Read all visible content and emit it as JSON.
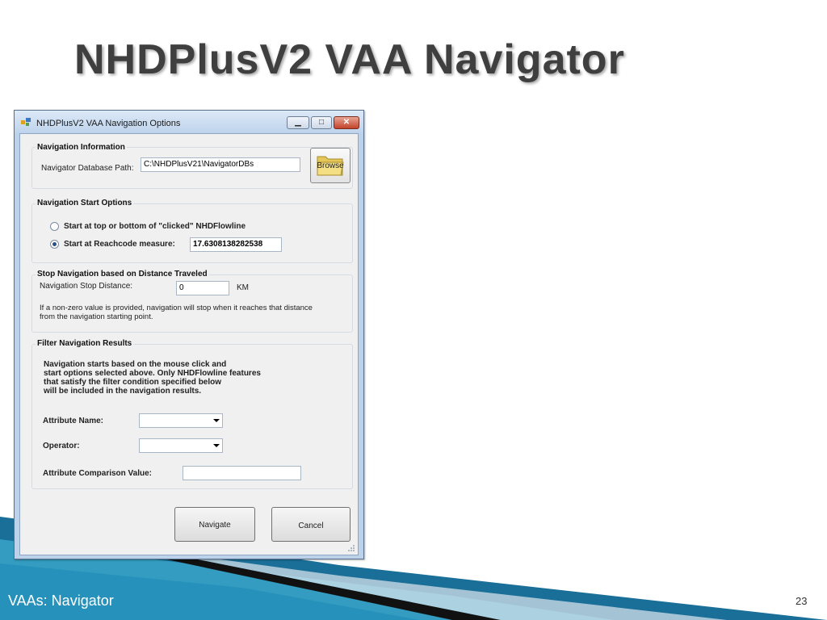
{
  "slide": {
    "title": "NHDPlusV2 VAA Navigator",
    "footer": "VAAs: Navigator",
    "page_number": "23"
  },
  "window": {
    "title": "NHDPlusV2 VAA Navigation Options",
    "icon": "app-icon",
    "controls": {
      "minimize": "minimize-icon",
      "maximize": "maximize-icon",
      "close": "close-icon"
    }
  },
  "nav_info": {
    "title": "Navigation Information",
    "db_path_label": "Navigator Database Path:",
    "db_path_value": "C:\\NHDPlusV21\\NavigatorDBs",
    "browse_label": "Browse"
  },
  "start_options": {
    "title": "Navigation Start Options",
    "option_top_bottom": "Start at top or bottom of \"clicked\" NHDFlowline",
    "option_reachcode": "Start at Reachcode measure:",
    "reachcode_value": "17.6308138282538",
    "selected": "option_reachcode"
  },
  "stop_nav": {
    "title": "Stop Navigation based on Distance Traveled",
    "distance_label": "Navigation Stop Distance:",
    "distance_value": "0",
    "unit": "KM",
    "note_line1": "If a non-zero value is provided, navigation will stop when it reaches that distance",
    "note_line2": "from the navigation starting point."
  },
  "filter": {
    "title": "Filter Navigation Results",
    "desc_line1": "Navigation starts based on the mouse click and",
    "desc_line2": "start options selected above.  Only NHDFlowline features",
    "desc_line3": "that satisfy the filter condition specified below",
    "desc_line4": "will be included in the navigation results.",
    "attribute_label": "Attribute Name:",
    "attribute_value": "",
    "operator_label": "Operator:",
    "operator_value": "",
    "comparison_label": "Attribute Comparison Value:",
    "comparison_value": ""
  },
  "buttons": {
    "navigate": "Navigate",
    "cancel": "Cancel"
  },
  "colors": {
    "title_text": "#3f3f3f",
    "window_frame": "#bcd2ea",
    "close_button": "#c3432b",
    "footer_blue": "#1d6f9a"
  }
}
